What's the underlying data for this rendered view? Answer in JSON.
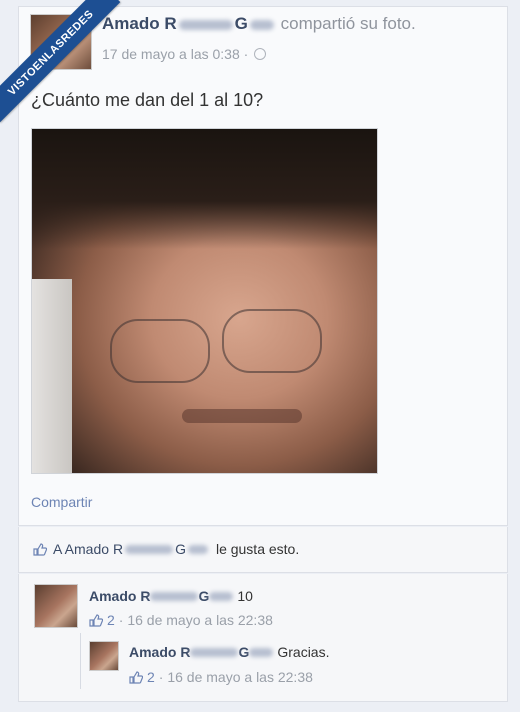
{
  "watermark": {
    "text": "VISTOENLASREDES"
  },
  "post": {
    "author_first": "Amado",
    "author_initial_1": "R",
    "author_initial_2": "G",
    "action": "compartió su foto.",
    "date": "17 de mayo a las 0:38 ·",
    "text": "¿Cuánto me dan del 1 al 10?",
    "share_label": "Compartir"
  },
  "likes": {
    "prefix": "A Amado",
    "initial_1": "R",
    "initial_2": "G",
    "suffix": "le gusta esto."
  },
  "comments": [
    {
      "author_first": "Amado",
      "initial_1": "R",
      "initial_2": "G",
      "text": "10",
      "like_count": "2",
      "date": "· 16 de mayo a las 22:38"
    },
    {
      "author_first": "Amado",
      "initial_1": "R",
      "initial_2": "G",
      "text": "Gracias.",
      "like_count": "2",
      "date": "· 16 de mayo a las 22:38"
    }
  ],
  "colors": {
    "link": "#3b4b67",
    "muted": "#9aa0a9",
    "accent": "#6d84b4",
    "ribbon": "#1d4f93"
  },
  "icons": [
    "globe-icon",
    "thumbs-up-icon"
  ]
}
